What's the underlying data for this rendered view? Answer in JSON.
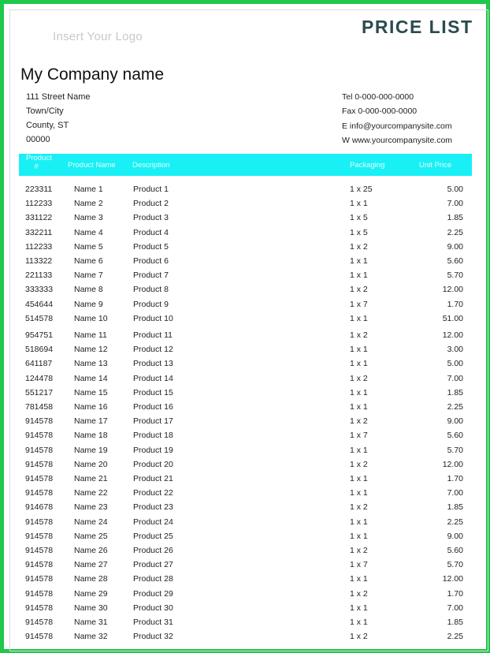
{
  "header": {
    "logo_placeholder": "Insert Your Logo",
    "title": "PRICE LIST",
    "company_name": "My Company name"
  },
  "address": [
    "111 Street Name",
    "Town/City",
    "County, ST",
    "00000"
  ],
  "contact": [
    "Tel  0-000-000-0000",
    "Fax  0-000-000-0000",
    "E  info@yourcompanysite.com",
    "W   www.yourcompanysite.com"
  ],
  "table": {
    "columns": {
      "code": "Product #",
      "name": "Product Name",
      "description": "Description",
      "packaging": "Packaging",
      "price": "Unit Price"
    },
    "header_color": "#19f0f5",
    "rows": [
      {
        "code": "223311",
        "name": "Name 1",
        "description": "Product 1",
        "packaging": "1 x 25",
        "price": "5.00"
      },
      {
        "code": "112233",
        "name": "Name 2",
        "description": "Product 2",
        "packaging": "1 x 1",
        "price": "7.00"
      },
      {
        "code": "331122",
        "name": "Name 3",
        "description": "Product 3",
        "packaging": "1 x 5",
        "price": "1.85"
      },
      {
        "code": "332211",
        "name": "Name 4",
        "description": "Product 4",
        "packaging": "1 x 5",
        "price": "2.25"
      },
      {
        "code": "112233",
        "name": "Name 5",
        "description": "Product 5",
        "packaging": "1 x 2",
        "price": "9.00"
      },
      {
        "code": "113322",
        "name": "Name 6",
        "description": "Product 6",
        "packaging": "1 x 1",
        "price": "5.60"
      },
      {
        "code": "221133",
        "name": "Name 7",
        "description": "Product 7",
        "packaging": "1 x 1",
        "price": "5.70"
      },
      {
        "code": "333333",
        "name": "Name 8",
        "description": "Product 8",
        "packaging": "1 x 2",
        "price": "12.00"
      },
      {
        "code": "454644",
        "name": "Name 9",
        "description": "Product 9",
        "packaging": "1 x 7",
        "price": "1.70"
      },
      {
        "code": "514578",
        "name": "Name 10",
        "description": "Product 10",
        "packaging": "1 x 1",
        "price": "51.00"
      },
      {
        "code": "954751",
        "name": "Name 11",
        "description": "Product 11",
        "packaging": "1 x 2",
        "price": "12.00"
      },
      {
        "code": "518694",
        "name": "Name 12",
        "description": "Product 12",
        "packaging": "1 x 1",
        "price": "3.00"
      },
      {
        "code": "641187",
        "name": "Name 13",
        "description": "Product 13",
        "packaging": "1 x 1",
        "price": "5.00"
      },
      {
        "code": "124478",
        "name": "Name 14",
        "description": "Product 14",
        "packaging": "1 x 2",
        "price": "7.00"
      },
      {
        "code": "551217",
        "name": "Name 15",
        "description": "Product 15",
        "packaging": "1 x 1",
        "price": "1.85"
      },
      {
        "code": "781458",
        "name": "Name 16",
        "description": "Product 16",
        "packaging": "1 x 1",
        "price": "2.25"
      },
      {
        "code": "914578",
        "name": "Name 17",
        "description": "Product 17",
        "packaging": "1 x 2",
        "price": "9.00"
      },
      {
        "code": "914578",
        "name": "Name 18",
        "description": "Product 18",
        "packaging": "1 x 7",
        "price": "5.60"
      },
      {
        "code": "914578",
        "name": "Name 19",
        "description": "Product 19",
        "packaging": "1 x 1",
        "price": "5.70"
      },
      {
        "code": "914578",
        "name": "Name 20",
        "description": "Product 20",
        "packaging": "1 x 2",
        "price": "12.00"
      },
      {
        "code": "914578",
        "name": "Name 21",
        "description": "Product 21",
        "packaging": "1 x 1",
        "price": "1.70"
      },
      {
        "code": "914578",
        "name": "Name 22",
        "description": "Product 22",
        "packaging": "1 x 1",
        "price": "7.00"
      },
      {
        "code": "914678",
        "name": "Name 23",
        "description": "Product 23",
        "packaging": "1 x 2",
        "price": "1.85"
      },
      {
        "code": "914578",
        "name": "Name 24",
        "description": "Product 24",
        "packaging": "1 x 1",
        "price": "2.25"
      },
      {
        "code": "914578",
        "name": "Name 25",
        "description": "Product 25",
        "packaging": "1 x 1",
        "price": "9.00"
      },
      {
        "code": "914578",
        "name": "Name 26",
        "description": "Product 26",
        "packaging": "1 x 2",
        "price": "5.60"
      },
      {
        "code": "914578",
        "name": "Name 27",
        "description": "Product 27",
        "packaging": "1 x 7",
        "price": "5.70"
      },
      {
        "code": "914578",
        "name": "Name 28",
        "description": "Product 28",
        "packaging": "1 x 1",
        "price": "12.00"
      },
      {
        "code": "914578",
        "name": "Name 29",
        "description": "Product 29",
        "packaging": "1 x 2",
        "price": "1.70"
      },
      {
        "code": "914578",
        "name": "Name 30",
        "description": "Product 30",
        "packaging": "1 x 1",
        "price": "7.00"
      },
      {
        "code": "914578",
        "name": "Name 31",
        "description": "Product 31",
        "packaging": "1 x 1",
        "price": "1.85"
      },
      {
        "code": "914578",
        "name": "Name 32",
        "description": "Product 32",
        "packaging": "1 x 2",
        "price": "2.25"
      }
    ]
  }
}
